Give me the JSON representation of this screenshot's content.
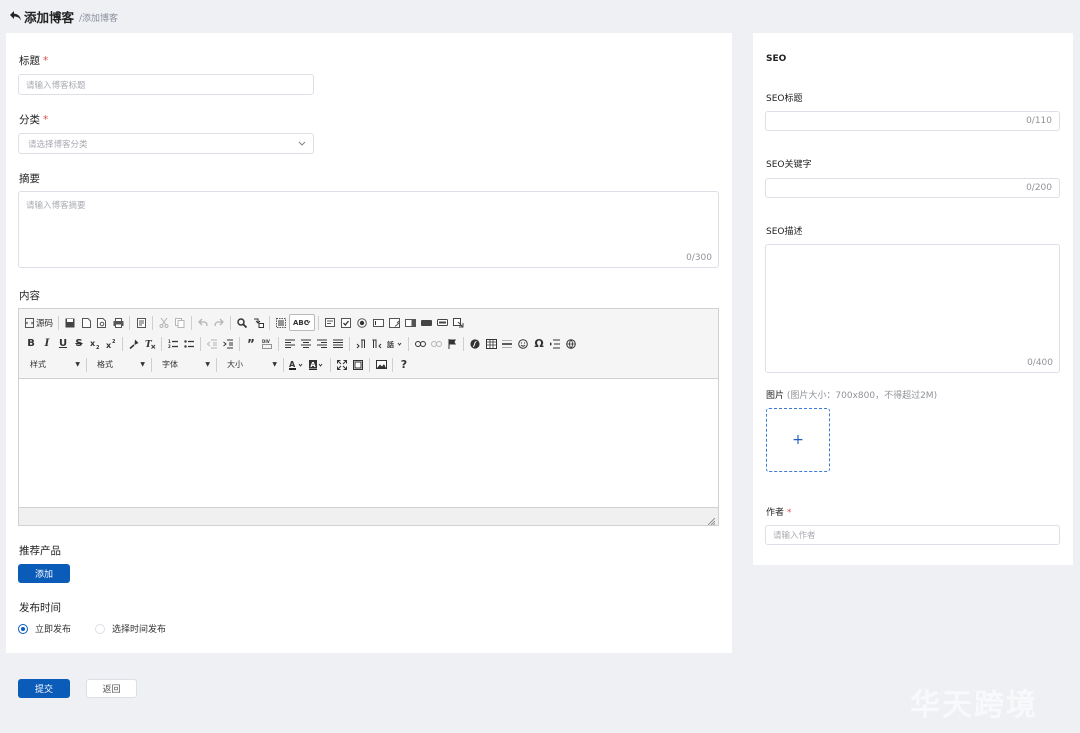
{
  "header": {
    "title": "添加博客",
    "breadcrumb": "/添加博客"
  },
  "form": {
    "title_label": "标题",
    "title_placeholder": "请输入博客标题",
    "category_label": "分类",
    "category_placeholder": "请选择博客分类",
    "summary_label": "摘要",
    "summary_placeholder": "请输入博客摘要",
    "summary_count": "0/300",
    "content_label": "内容",
    "recommend_label": "推荐产品",
    "add_button": "添加",
    "publish_label": "发布时间",
    "publish_options": [
      "立即发布",
      "选择时间发布"
    ],
    "publish_selected": "立即发布",
    "required_mark": "*"
  },
  "editor": {
    "source_label": "源码",
    "combos": [
      "样式",
      "格式",
      "字体",
      "大小"
    ],
    "toolbar_row1_icons": [
      "source-icon",
      "save-icon",
      "new-page-icon",
      "preview-icon",
      "print-icon",
      "templates-icon",
      "cut-icon",
      "copy-icon",
      "undo-icon",
      "redo-icon",
      "find-icon",
      "replace-icon",
      "select-all-icon",
      "spellcheck-icon",
      "form-icon",
      "checkbox-icon",
      "radio-icon",
      "textfield-icon",
      "textarea-icon",
      "select-icon",
      "button-icon",
      "hidden-field-icon",
      "image-button-icon"
    ],
    "toolbar_row2_icons": [
      "bold-icon",
      "italic-icon",
      "underline-icon",
      "strike-icon",
      "subscript-icon",
      "superscript-icon",
      "copy-format-icon",
      "remove-format-icon",
      "numbered-list-icon",
      "bulleted-list-icon",
      "outdent-icon",
      "indent-icon",
      "blockquote-icon",
      "div-icon",
      "align-left-icon",
      "align-center-icon",
      "align-right-icon",
      "justify-icon",
      "ltr-icon",
      "rtl-icon",
      "language-icon",
      "link-icon",
      "unlink-icon",
      "anchor-icon",
      "flash-icon",
      "table-icon",
      "horizontal-rule-icon",
      "smiley-icon",
      "special-char-icon",
      "page-break-icon",
      "iframe-icon"
    ],
    "toolbar_row3_icons": [
      "text-color-icon",
      "bg-color-icon",
      "maximize-icon",
      "show-blocks-icon",
      "image-icon",
      "help-icon"
    ]
  },
  "actions": {
    "submit": "提交",
    "back": "返回"
  },
  "seo": {
    "section_title": "SEO",
    "title_label": "SEO标题",
    "title_count": "0/110",
    "keywords_label": "SEO关键字",
    "keywords_count": "0/200",
    "description_label": "SEO描述",
    "description_count": "0/400",
    "image_label": "图片",
    "image_hint": "(图片大小：700x800，不得超过2M)",
    "upload_plus": "+",
    "author_label": "作者",
    "author_placeholder": "请输入作者"
  },
  "watermark": "华天跨境",
  "colors": {
    "primary": "#0a5cb8",
    "required": "#e34d4d",
    "background": "#eef0f4"
  }
}
